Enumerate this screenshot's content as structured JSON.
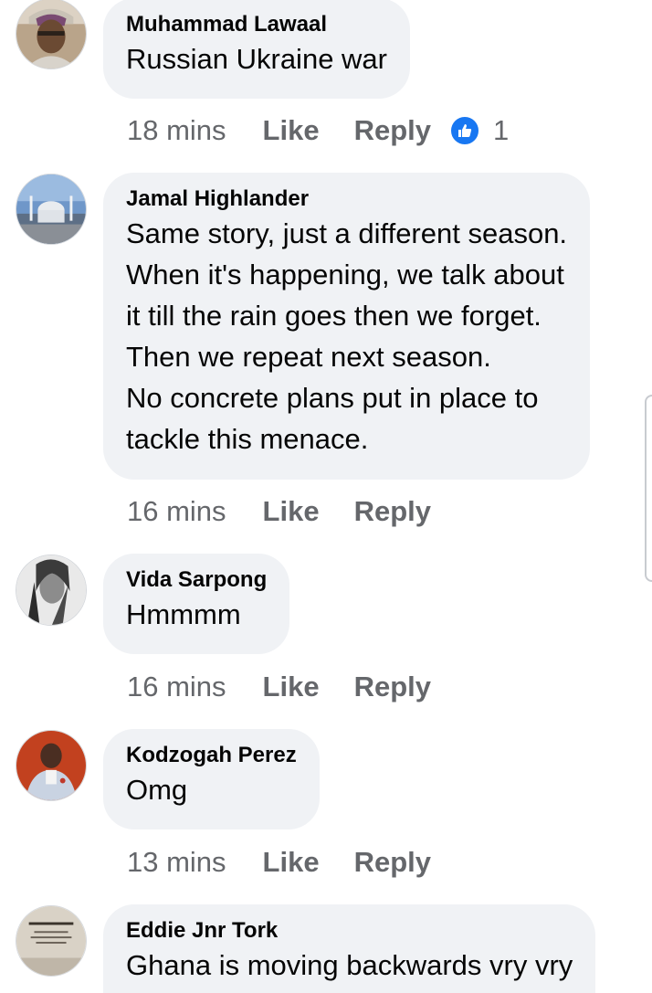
{
  "comments": [
    {
      "author": "Muhammad Lawaal",
      "lines": [
        "Russian Ukraine war"
      ],
      "time": "18 mins",
      "like_label": "Like",
      "reply_label": "Reply",
      "reaction_count": "1",
      "avatar_icon": "profile-photo"
    },
    {
      "author": "Jamal Highlander",
      "lines": [
        "Same story, just a different season.",
        "When it's happening, we talk about",
        "it till the rain goes then we forget.",
        "Then we repeat next season.",
        "No concrete plans put in place to",
        "tackle this menace."
      ],
      "time": "16 mins",
      "like_label": "Like",
      "reply_label": "Reply",
      "avatar_icon": "mosque-photo"
    },
    {
      "author": "Vida Sarpong",
      "lines": [
        "Hmmmm"
      ],
      "time": "16 mins",
      "like_label": "Like",
      "reply_label": "Reply",
      "avatar_icon": "profile-photo"
    },
    {
      "author": "Kodzogah Perez",
      "lines": [
        "Omg"
      ],
      "time": "13 mins",
      "like_label": "Like",
      "reply_label": "Reply",
      "avatar_icon": "profile-photo"
    },
    {
      "author": "Eddie Jnr Tork",
      "lines": [
        "Ghana is moving backwards vry vry"
      ],
      "avatar_icon": "quote-image"
    }
  ],
  "colors": {
    "bubble": "#f0f2f5",
    "meta_text": "#65676b",
    "like_reaction": "#1877f2"
  }
}
